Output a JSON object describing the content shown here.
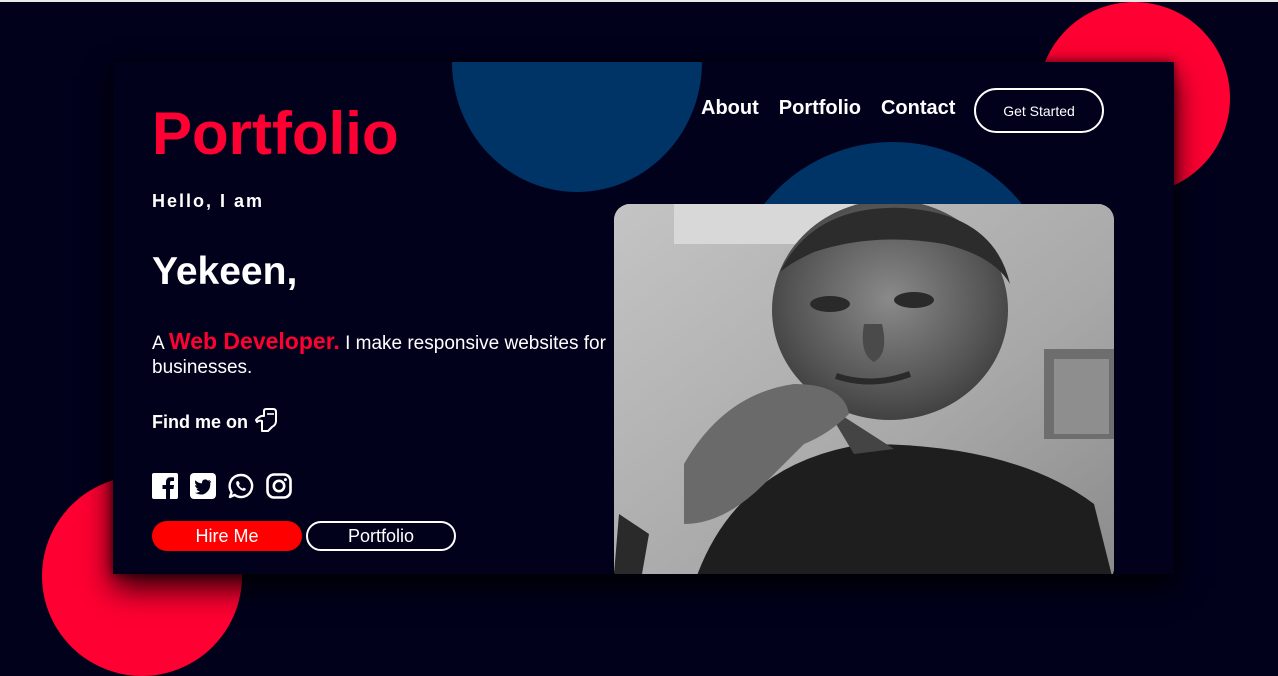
{
  "logo": "Portfolio",
  "nav": {
    "items": [
      "About",
      "Portfolio",
      "Contact"
    ],
    "cta": "Get Started"
  },
  "hero": {
    "greeting": "Hello, I am",
    "name": "Yekeen,",
    "bio_prefix": "A",
    "role": "Web Developer.",
    "bio_suffix": "I make responsive websites for businesses.",
    "find_me": "Find me on"
  },
  "socials": [
    "facebook-icon",
    "twitter-icon",
    "whatsapp-icon",
    "instagram-icon"
  ],
  "buttons": {
    "hire": "Hire Me",
    "portfolio": "Portfolio"
  },
  "colors": {
    "background": "#01011c",
    "accent_red": "#fe0032",
    "accent_blue": "#003366",
    "text": "#ffffff"
  }
}
